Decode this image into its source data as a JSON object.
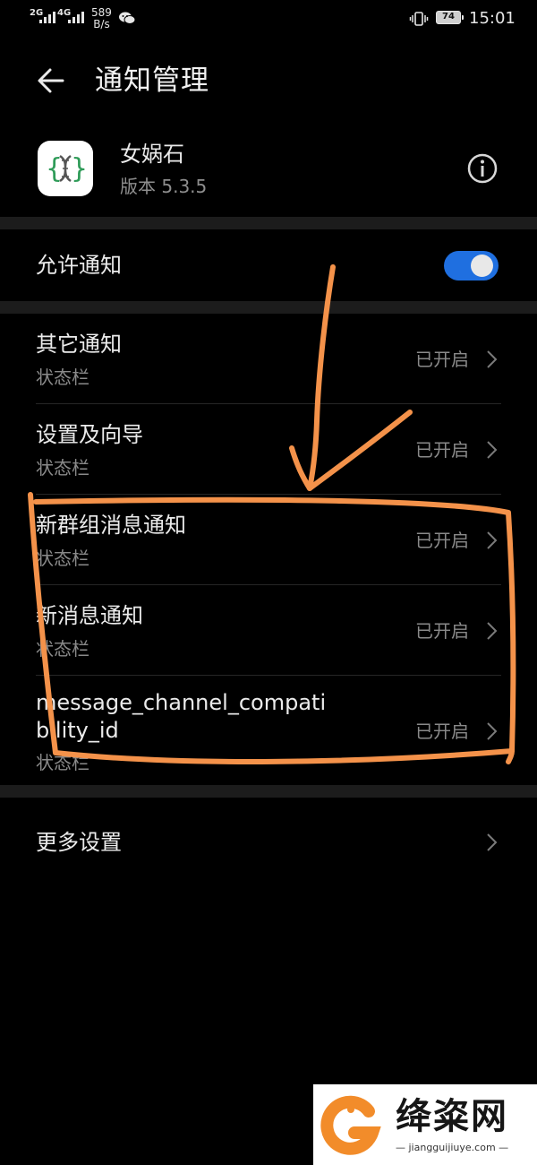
{
  "status_bar": {
    "net1": "2G",
    "net2": "4G",
    "speed_value": "589",
    "speed_unit": "B/s",
    "battery": "74",
    "time": "15:01"
  },
  "header": {
    "title": "通知管理"
  },
  "app": {
    "name": "女娲石",
    "version": "版本 5.3.5"
  },
  "allow": {
    "label": "允许通知",
    "enabled": true
  },
  "channels": [
    {
      "title": "其它通知",
      "subtitle": "状态栏",
      "status": "已开启"
    },
    {
      "title": "设置及向导",
      "subtitle": "状态栏",
      "status": "已开启"
    },
    {
      "title": "新群组消息通知",
      "subtitle": "状态栏",
      "status": "已开启"
    },
    {
      "title": "新消息通知",
      "subtitle": "状态栏",
      "status": "已开启"
    },
    {
      "title_line1": "message_channel_compati",
      "title_line2": "bility_id",
      "subtitle": "状态栏",
      "status": "已开启"
    }
  ],
  "more": {
    "label": "更多设置"
  },
  "watermark": {
    "text": "绛粢网",
    "domain": "— jiangguijiuye.com —"
  },
  "colors": {
    "background": "#000000",
    "accent": "#1f6fe0",
    "annotation": "#f4924a"
  }
}
